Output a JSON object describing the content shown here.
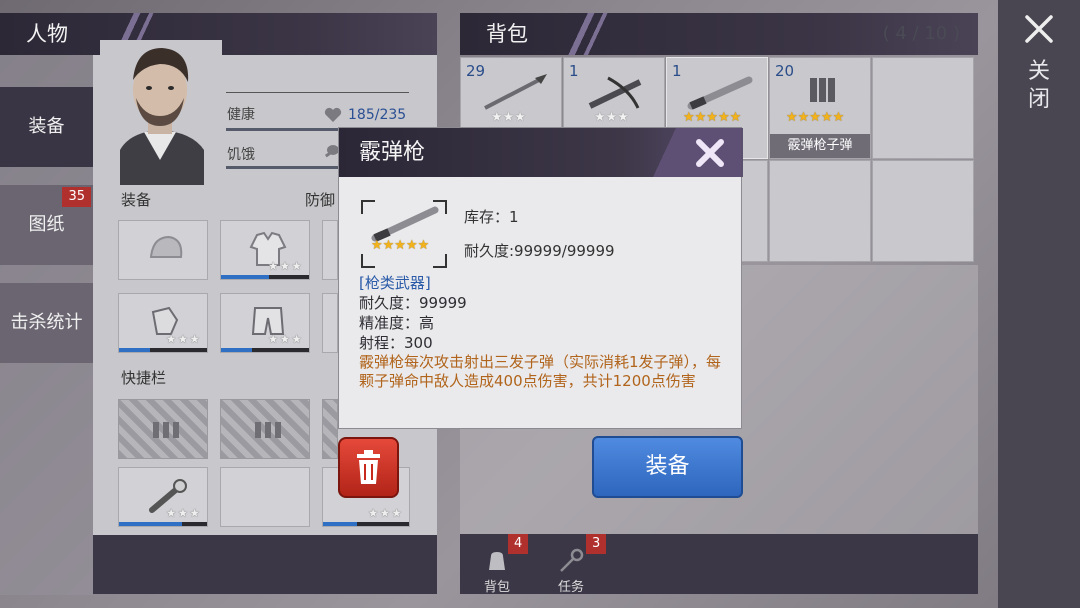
{
  "character": {
    "title": "人物",
    "tabs": [
      {
        "label": "装备"
      },
      {
        "label": "图纸",
        "badge": "35"
      },
      {
        "label": "击杀统计"
      }
    ],
    "stats": [
      {
        "label": "健康",
        "value": "185/235",
        "icon": "heart-icon"
      },
      {
        "label": "饥饿",
        "icon": "drumstick-icon"
      }
    ],
    "equipment_label": "装备",
    "defense_label": "防御",
    "quickbar_label": "快捷栏",
    "slots_stars": "★★★"
  },
  "backpack": {
    "title": "背包",
    "count": "( 4 / 10 )",
    "items": [
      {
        "qty": "29",
        "stars": "★★★",
        "icon": "spear-icon"
      },
      {
        "qty": "1",
        "stars": "★★★",
        "icon": "crossbow-icon"
      },
      {
        "qty": "1",
        "stars": "★★★★★",
        "icon": "shotgun-icon"
      },
      {
        "qty": "20",
        "stars": "★★★★★",
        "icon": "shells-icon",
        "name": "霰弹枪子弹"
      }
    ],
    "bottom_tabs": [
      {
        "label": "背包",
        "badge": "4",
        "icon": "backpack-icon"
      },
      {
        "label": "任务",
        "badge": "3",
        "icon": "key-icon"
      }
    ]
  },
  "close": {
    "label": "关闭"
  },
  "popup": {
    "title": "霰弹枪",
    "stock": "库存：1",
    "durability_line": "耐久度:99999/99999",
    "stars": "★★★★★",
    "category": "[枪类武器]",
    "attrs": [
      "耐久度：99999",
      "精准度：高",
      "射程：300"
    ],
    "description": "霰弹枪每次攻击射出三发子弹（实际消耗1发子弹），每颗子弹命中敌人造成400点伤害，共计1200点伤害"
  },
  "buttons": {
    "equip": "装备"
  },
  "colors": {
    "accent_blue": "#2e66bd",
    "badge_red": "#b0302e",
    "star_gold": "#f2b21b",
    "desc_orange": "#b1641b"
  }
}
